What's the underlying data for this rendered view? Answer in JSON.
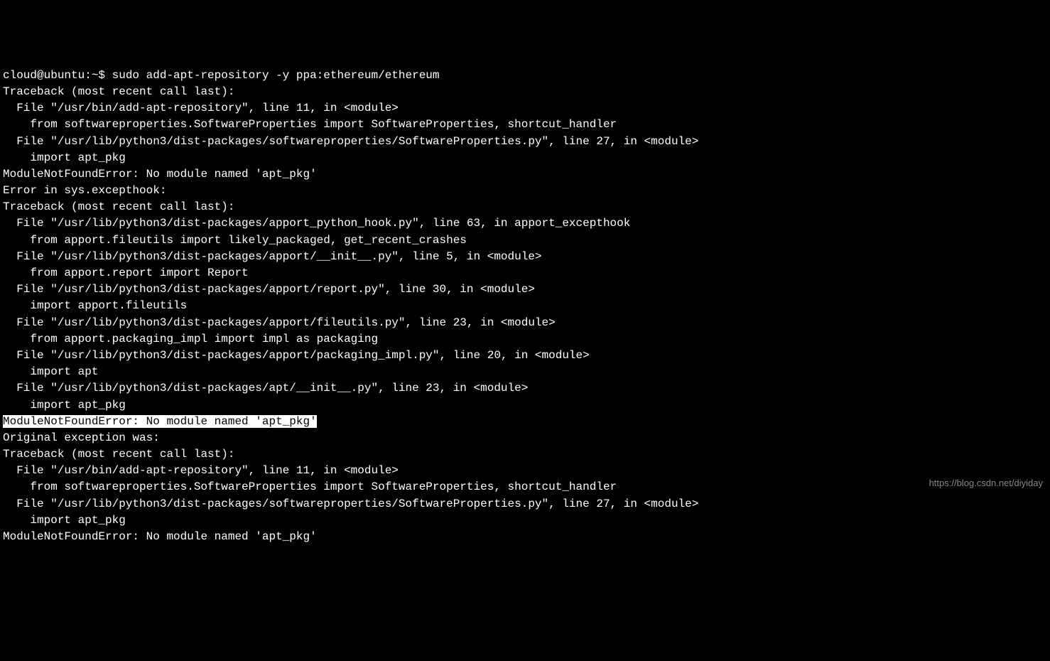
{
  "terminal": {
    "lines": {
      "l0_prompt": "cloud@ubuntu:~$ ",
      "l0_cmd": "sudo add-apt-repository -y ppa:ethereum/ethereum",
      "l1": "Traceback (most recent call last):",
      "l2": "  File \"/usr/bin/add-apt-repository\", line 11, in <module>",
      "l3": "    from softwareproperties.SoftwareProperties import SoftwareProperties, shortcut_handler",
      "l4": "  File \"/usr/lib/python3/dist-packages/softwareproperties/SoftwareProperties.py\", line 27, in <module>",
      "l5": "    import apt_pkg",
      "l6": "ModuleNotFoundError: No module named 'apt_pkg'",
      "l7": "Error in sys.excepthook:",
      "l8": "Traceback (most recent call last):",
      "l9": "  File \"/usr/lib/python3/dist-packages/apport_python_hook.py\", line 63, in apport_excepthook",
      "l10": "    from apport.fileutils import likely_packaged, get_recent_crashes",
      "l11": "  File \"/usr/lib/python3/dist-packages/apport/__init__.py\", line 5, in <module>",
      "l12": "    from apport.report import Report",
      "l13": "  File \"/usr/lib/python3/dist-packages/apport/report.py\", line 30, in <module>",
      "l14": "    import apport.fileutils",
      "l15": "  File \"/usr/lib/python3/dist-packages/apport/fileutils.py\", line 23, in <module>",
      "l16": "    from apport.packaging_impl import impl as packaging",
      "l17": "  File \"/usr/lib/python3/dist-packages/apport/packaging_impl.py\", line 20, in <module>",
      "l18": "    import apt",
      "l19": "  File \"/usr/lib/python3/dist-packages/apt/__init__.py\", line 23, in <module>",
      "l20": "    import apt_pkg",
      "l21_highlighted": "ModuleNotFoundError: No module named 'apt_pkg'",
      "l22": "",
      "l23": "Original exception was:",
      "l24": "Traceback (most recent call last):",
      "l25": "  File \"/usr/bin/add-apt-repository\", line 11, in <module>",
      "l26": "    from softwareproperties.SoftwareProperties import SoftwareProperties, shortcut_handler",
      "l27": "  File \"/usr/lib/python3/dist-packages/softwareproperties/SoftwareProperties.py\", line 27, in <module>",
      "l28": "    import apt_pkg",
      "l29": "ModuleNotFoundError: No module named 'apt_pkg'"
    }
  },
  "watermark": "https://blog.csdn.net/diyiday"
}
